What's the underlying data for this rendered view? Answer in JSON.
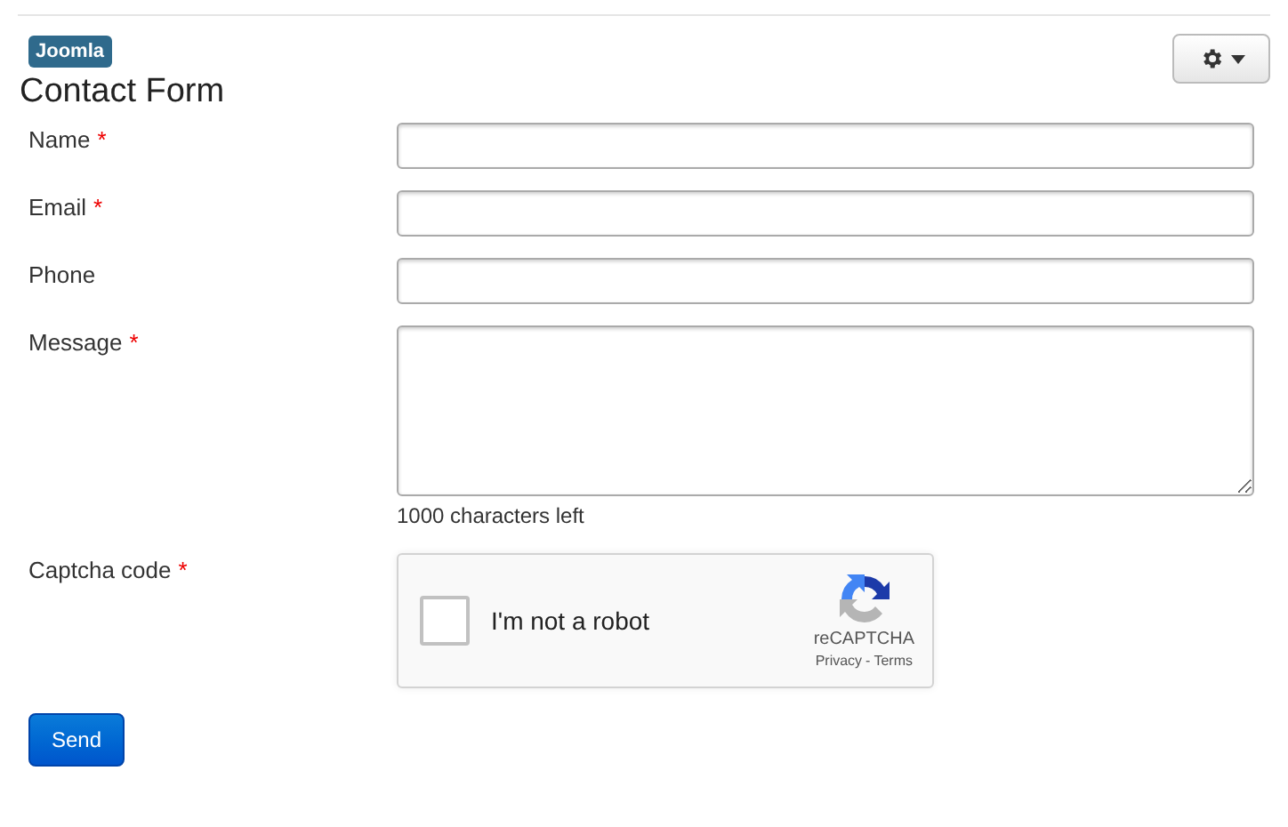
{
  "badge": "Joomla",
  "title": "Contact Form",
  "fields": [
    {
      "kind": "input",
      "label": "Name",
      "required_mark": "*"
    },
    {
      "kind": "input",
      "label": "Email",
      "required_mark": "*"
    },
    {
      "kind": "input",
      "label": "Phone"
    },
    {
      "kind": "textarea",
      "label": "Message",
      "required_mark": "*",
      "help": "1000 characters left"
    },
    {
      "kind": "captcha",
      "label": "Captcha code",
      "required_mark": "*",
      "captcha": {
        "checked": false,
        "text": "I'm not a robot",
        "brand": "reCAPTCHA",
        "privacy": "Privacy",
        "separator": "-",
        "terms": "Terms"
      }
    }
  ],
  "submit": "Send"
}
